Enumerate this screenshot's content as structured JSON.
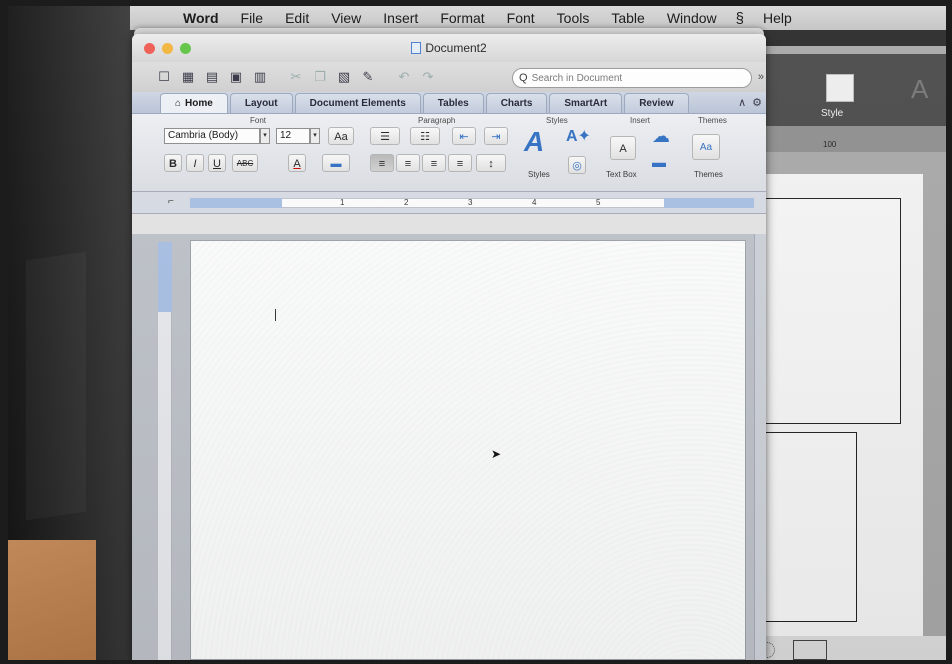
{
  "menubar": {
    "apple_glyph": "",
    "items": [
      "Word",
      "File",
      "Edit",
      "View",
      "Insert",
      "Format",
      "Font",
      "Tools",
      "Table",
      "Window",
      "Help"
    ]
  },
  "window": {
    "title": "Document2"
  },
  "toolbar": {
    "search_placeholder": "Search in Document",
    "overflow": "»"
  },
  "ribbon": {
    "tabs": [
      "Home",
      "Layout",
      "Document Elements",
      "Tables",
      "Charts",
      "SmartArt",
      "Review"
    ],
    "active_tab": "Home",
    "groups": {
      "font_label": "Font",
      "paragraph_label": "Paragraph",
      "styles_label": "Styles",
      "insert_label": "Insert",
      "themes_label": "Themes"
    },
    "font_name": "Cambria (Body)",
    "font_size": "12",
    "bold": "B",
    "italic": "I",
    "underline": "U",
    "strike": "ABC",
    "styles_button_label": "Styles",
    "textbox_button_label": "Text Box",
    "themes_button_label": "Themes"
  },
  "ruler": {
    "numbers": [
      "1",
      "2",
      "3",
      "4",
      "5"
    ]
  },
  "background_window": {
    "style_label": "Style",
    "ruler_tick": "100"
  },
  "colors": {
    "accent": "#2f6fc4",
    "ribbon_tab_bg": "#c1cbdc",
    "page": "#ffffff"
  }
}
